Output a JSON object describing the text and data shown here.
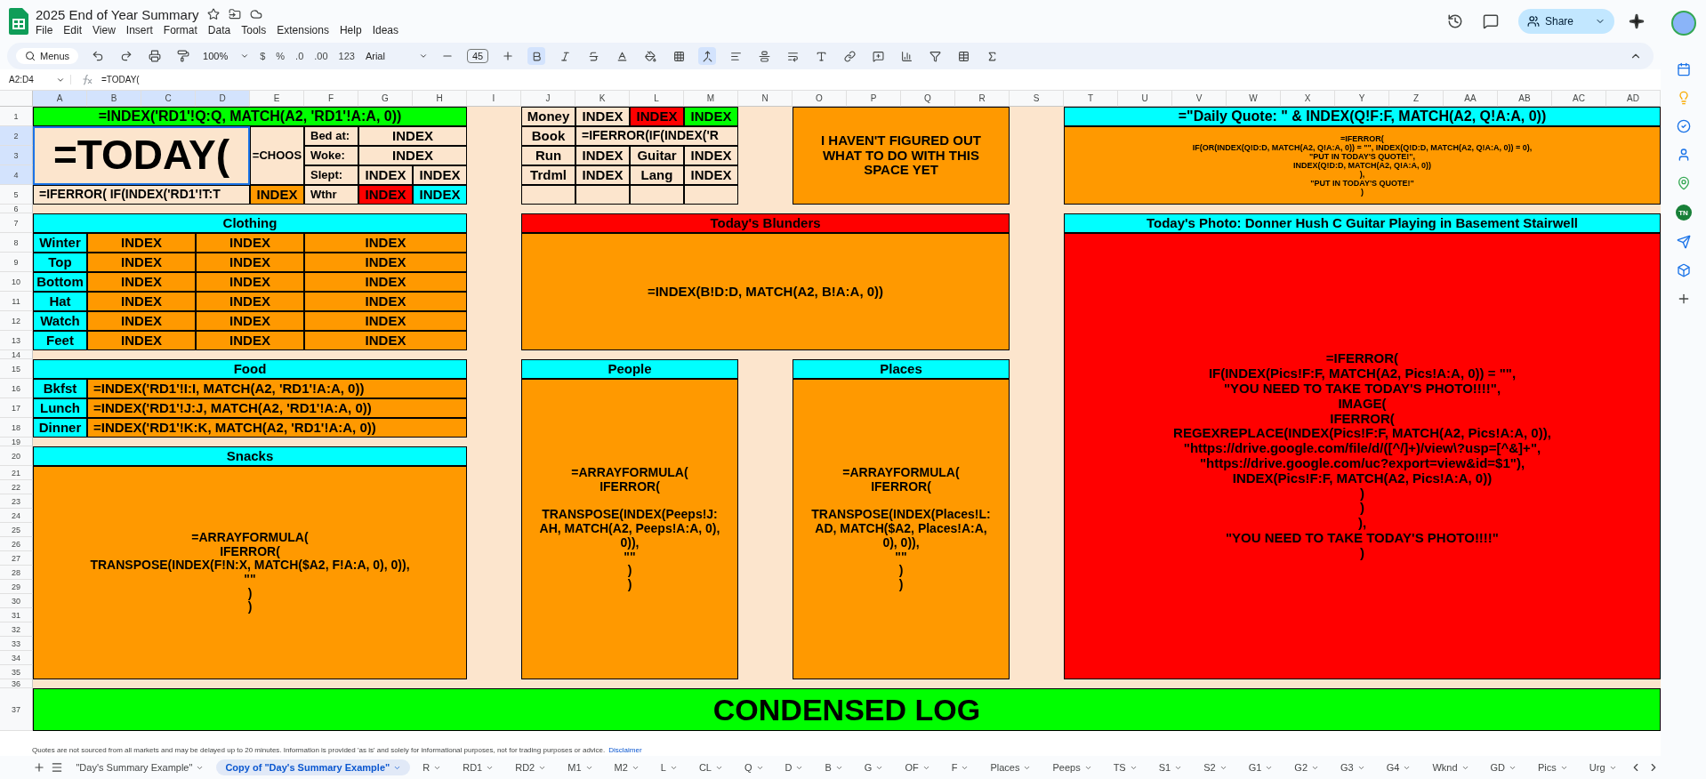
{
  "document": {
    "title": "2025 End of Year Summary"
  },
  "menu": [
    "File",
    "Edit",
    "View",
    "Insert",
    "Format",
    "Data",
    "Tools",
    "Extensions",
    "Help",
    "Ideas"
  ],
  "share": "Share",
  "toolbar": {
    "search": "Menus",
    "zoom": "100%",
    "number_formats": [
      "$",
      "%",
      ".0",
      ".00",
      "123"
    ],
    "font": "Arial",
    "font_size": "45",
    "bold": {
      "selected": true
    },
    "merge_cells": {
      "selected": true
    }
  },
  "formula_bar": {
    "cell": "A2:D4",
    "formula": "=TODAY("
  },
  "side_panel": {
    "badge": "TN"
  },
  "columns": [
    {
      "label": "A",
      "selected": true
    },
    {
      "label": "B",
      "selected": true
    },
    {
      "label": "C",
      "selected": true
    },
    {
      "label": "D",
      "selected": true
    },
    {
      "label": "E",
      "selected": false
    },
    {
      "label": "F",
      "selected": false
    },
    {
      "label": "G",
      "selected": false
    },
    {
      "label": "H",
      "selected": false
    },
    {
      "label": "I",
      "selected": false
    },
    {
      "label": "J",
      "selected": false
    },
    {
      "label": "K",
      "selected": false
    },
    {
      "label": "L",
      "selected": false
    },
    {
      "label": "M",
      "selected": false
    },
    {
      "label": "N",
      "selected": false
    },
    {
      "label": "O",
      "selected": false
    },
    {
      "label": "P",
      "selected": false
    },
    {
      "label": "Q",
      "selected": false
    },
    {
      "label": "R",
      "selected": false
    },
    {
      "label": "S",
      "selected": false
    },
    {
      "label": "T",
      "selected": false
    },
    {
      "label": "U",
      "selected": false
    },
    {
      "label": "V",
      "selected": false
    },
    {
      "label": "W",
      "selected": false
    },
    {
      "label": "X",
      "selected": false
    },
    {
      "label": "Y",
      "selected": false
    },
    {
      "label": "Z",
      "selected": false
    },
    {
      "label": "AA",
      "selected": false
    },
    {
      "label": "AB",
      "selected": false
    },
    {
      "label": "AC",
      "selected": false
    },
    {
      "label": "AD",
      "selected": false
    }
  ],
  "rows": [
    {
      "label": "1",
      "selected": false
    },
    {
      "label": "2",
      "selected": true
    },
    {
      "label": "3",
      "selected": true
    },
    {
      "label": "4",
      "selected": true
    },
    {
      "label": "5",
      "selected": false
    },
    {
      "label": "6",
      "selected": false
    },
    {
      "label": "7",
      "selected": false
    },
    {
      "label": "8",
      "selected": false
    },
    {
      "label": "9",
      "selected": false
    },
    {
      "label": "10",
      "selected": false
    },
    {
      "label": "11",
      "selected": false
    },
    {
      "label": "12",
      "selected": false
    },
    {
      "label": "13",
      "selected": false
    },
    {
      "label": "14",
      "selected": false
    },
    {
      "label": "15",
      "selected": false
    },
    {
      "label": "16",
      "selected": false
    },
    {
      "label": "17",
      "selected": false
    },
    {
      "label": "18",
      "selected": false
    },
    {
      "label": "19",
      "selected": false
    },
    {
      "label": "20",
      "selected": false
    },
    {
      "label": "21",
      "selected": false
    },
    {
      "label": "22",
      "selected": false
    },
    {
      "label": "23",
      "selected": false
    },
    {
      "label": "24",
      "selected": false
    },
    {
      "label": "25",
      "selected": false
    },
    {
      "label": "26",
      "selected": false
    },
    {
      "label": "27",
      "selected": false
    },
    {
      "label": "28",
      "selected": false
    },
    {
      "label": "29",
      "selected": false
    },
    {
      "label": "30",
      "selected": false
    },
    {
      "label": "31",
      "selected": false
    },
    {
      "label": "32",
      "selected": false
    },
    {
      "label": "33",
      "selected": false
    },
    {
      "label": "34",
      "selected": false
    },
    {
      "label": "35",
      "selected": false
    },
    {
      "label": "36",
      "selected": false
    },
    {
      "label": "37",
      "selected": false
    }
  ],
  "cells": [
    {
      "text": "=INDEX('RD1'!Q:Q, MATCH(A2, 'RD1'!A:A, 0))",
      "color": "#00ff00",
      "selected": false
    },
    {
      "text": "=TODAY(",
      "color": "#fce5cd",
      "selected": true
    },
    {
      "text": "=CHOOS",
      "color": "#fce5cd",
      "selected": false
    },
    {
      "text": "Bed at:",
      "color": "#fce5cd",
      "selected": false
    },
    {
      "text": "INDEX",
      "color": "#fce5cd",
      "selected": false
    },
    {
      "text": "Woke:",
      "color": "#fce5cd",
      "selected": false
    },
    {
      "text": "INDEX",
      "color": "#fce5cd",
      "selected": false
    },
    {
      "text": "Slept:",
      "color": "#fce5cd",
      "selected": false
    },
    {
      "text": "INDEX",
      "color": "#fce5cd",
      "selected": false
    },
    {
      "text": "INDEX",
      "color": "#fce5cd",
      "selected": false
    },
    {
      "text": "=IFERROR( IF(INDEX('RD1'!T:T",
      "color": "#fce5cd",
      "selected": false
    },
    {
      "text": "INDEX",
      "color": "#ff9900",
      "selected": false
    },
    {
      "text": "Wthr",
      "color": "#fce5cd",
      "selected": false
    },
    {
      "text": "INDEX",
      "color": "#ff0000",
      "selected": false
    },
    {
      "text": "INDEX",
      "color": "#00ffff",
      "selected": false
    },
    {
      "text": "Money",
      "color": "#fce5cd",
      "selected": false
    },
    {
      "text": "INDEX",
      "color": "#fce5cd",
      "selected": false
    },
    {
      "text": "INDEX",
      "color": "#ff0000",
      "selected": false
    },
    {
      "text": "INDEX",
      "color": "#00ff00",
      "selected": false
    },
    {
      "text": "Book",
      "color": "#fce5cd",
      "selected": false
    },
    {
      "text": "=IFERROR(IF(INDEX('R",
      "color": "#fce5cd",
      "selected": false
    },
    {
      "text": "Run",
      "color": "#fce5cd",
      "selected": false
    },
    {
      "text": "INDEX",
      "color": "#fce5cd",
      "selected": false
    },
    {
      "text": "Guitar",
      "color": "#fce5cd",
      "selected": false
    },
    {
      "text": "INDEX",
      "color": "#fce5cd",
      "selected": false
    },
    {
      "text": "Trdml",
      "color": "#fce5cd",
      "selected": false
    },
    {
      "text": "INDEX",
      "color": "#fce5cd",
      "selected": false
    },
    {
      "text": "Lang",
      "color": "#fce5cd",
      "selected": false
    },
    {
      "text": "INDEX",
      "color": "#fce5cd",
      "selected": false
    },
    {
      "color": "#fce5cd",
      "selected": false
    },
    {
      "color": "#fce5cd",
      "selected": false
    },
    {
      "color": "#fce5cd",
      "selected": false
    },
    {
      "color": "#fce5cd",
      "selected": false
    },
    {
      "text": "I HAVEN'T FIGURED OUT\nWHAT TO DO WITH THIS\nSPACE YET",
      "color": "#ff9900",
      "selected": false
    },
    {
      "text": "=\"Daily Quote: \" & INDEX(Q!F:F, MATCH(A2, Q!A:A, 0))",
      "color": "#00ffff",
      "selected": false
    },
    {
      "text": "=IFERROR(\nIF(OR(INDEX(Q!D:D, MATCH(A2, Q!A:A, 0)) = \"\", INDEX(Q!D:D, MATCH(A2, Q!A:A, 0)) = 0),\n\"PUT IN TODAY'S QUOTE!\",\nINDEX(Q!D:D, MATCH(A2, Q!A:A, 0))\n),\n\"PUT IN TODAY'S QUOTE!\"\n)",
      "color": "#ff9900",
      "selected": false
    },
    {
      "text": "Clothing",
      "color": "#00ffff",
      "selected": false
    },
    {
      "text": "Winter",
      "color": "#00ffff",
      "selected": false
    },
    {
      "text": "INDEX",
      "color": "#ff9900",
      "selected": false
    },
    {
      "text": "INDEX",
      "color": "#ff9900",
      "selected": false
    },
    {
      "text": "INDEX",
      "color": "#ff9900",
      "selected": false
    },
    {
      "text": "Top",
      "color": "#00ffff",
      "selected": false
    },
    {
      "text": "INDEX",
      "color": "#ff9900",
      "selected": false
    },
    {
      "text": "INDEX",
      "color": "#ff9900",
      "selected": false
    },
    {
      "text": "INDEX",
      "color": "#ff9900",
      "selected": false
    },
    {
      "text": "Bottom",
      "color": "#00ffff",
      "selected": false
    },
    {
      "text": "INDEX",
      "color": "#ff9900",
      "selected": false
    },
    {
      "text": "INDEX",
      "color": "#ff9900",
      "selected": false
    },
    {
      "text": "INDEX",
      "color": "#ff9900",
      "selected": false
    },
    {
      "text": "Hat",
      "color": "#00ffff",
      "selected": false
    },
    {
      "text": "INDEX",
      "color": "#ff9900",
      "selected": false
    },
    {
      "text": "INDEX",
      "color": "#ff9900",
      "selected": false
    },
    {
      "text": "INDEX",
      "color": "#ff9900",
      "selected": false
    },
    {
      "text": "Watch",
      "color": "#00ffff",
      "selected": false
    },
    {
      "text": "INDEX",
      "color": "#ff9900",
      "selected": false
    },
    {
      "text": "INDEX",
      "color": "#ff9900",
      "selected": false
    },
    {
      "text": "INDEX",
      "color": "#ff9900",
      "selected": false
    },
    {
      "text": "Feet",
      "color": "#00ffff",
      "selected": false
    },
    {
      "text": "INDEX",
      "color": "#ff9900",
      "selected": false
    },
    {
      "text": "INDEX",
      "color": "#ff9900",
      "selected": false
    },
    {
      "text": "INDEX",
      "color": "#ff9900",
      "selected": false
    },
    {
      "text": "Today's Blunders",
      "color": "#ff0000",
      "selected": false
    },
    {
      "text": "=INDEX(B!D:D, MATCH(A2, B!A:A, 0))",
      "color": "#ff9900",
      "selected": false
    },
    {
      "text": "Today's Photo: Donner Hush C Guitar Playing in Basement Stairwell",
      "color": "#00ffff",
      "selected": false
    },
    {
      "text": "=IFERROR(\nIF(INDEX(Pics!F:F, MATCH(A2, Pics!A:A, 0)) = \"\",\n\"YOU NEED TO TAKE TODAY'S PHOTO!!!!\",\nIMAGE(\nIFERROR(\nREGEXREPLACE(INDEX(Pics!F:F, MATCH(A2, Pics!A:A, 0)),\n\"https://drive.google.com/file/d/([^/]+)/view\\?usp=[^&]+\",\n\"https://drive.google.com/uc?export=view&id=$1\"),\nINDEX(Pics!F:F, MATCH(A2, Pics!A:A, 0))\n)\n)\n),\n\"YOU NEED TO TAKE TODAY'S PHOTO!!!!\"\n)",
      "color": "#ff0000",
      "selected": false
    },
    {
      "text": "Food",
      "color": "#00ffff",
      "selected": false
    },
    {
      "text": "Bkfst",
      "color": "#00ffff",
      "selected": false
    },
    {
      "text": "=INDEX('RD1'!I:I, MATCH(A2, 'RD1'!A:A, 0))",
      "color": "#ff9900",
      "selected": false
    },
    {
      "text": "Lunch",
      "color": "#00ffff",
      "selected": false
    },
    {
      "text": "=INDEX('RD1'!J:J, MATCH(A2, 'RD1'!A:A, 0))",
      "color": "#ff9900",
      "selected": false
    },
    {
      "text": "Dinner",
      "color": "#00ffff",
      "selected": false
    },
    {
      "text": "=INDEX('RD1'!K:K, MATCH(A2, 'RD1'!A:A, 0))",
      "color": "#ff9900",
      "selected": false
    },
    {
      "text": "People",
      "color": "#00ffff",
      "selected": false
    },
    {
      "text": "=ARRAYFORMULA(\nIFERROR(\n\nTRANSPOSE(INDEX(Peeps!J:\nAH, MATCH(A2, Peeps!A:A, 0),\n0)),\n\"\"\n)\n)",
      "color": "#ff9900",
      "selected": false
    },
    {
      "text": "Places",
      "color": "#00ffff",
      "selected": false
    },
    {
      "text": "=ARRAYFORMULA(\nIFERROR(\n\nTRANSPOSE(INDEX(Places!L:\nAD, MATCH($A2, Places!A:A,\n0), 0)),\n\"\"\n)\n)",
      "color": "#ff9900",
      "selected": false
    },
    {
      "text": "Snacks",
      "color": "#00ffff",
      "selected": false
    },
    {
      "text": "=ARRAYFORMULA(\nIFERROR(\nTRANSPOSE(INDEX(F!N:X, MATCH($A2, F!A:A, 0), 0)),\n\"\"\n)\n)",
      "color": "#ff9900",
      "selected": false
    },
    {
      "text": "CONDENSED LOG",
      "color": "#00ff00",
      "selected": false
    }
  ],
  "notice": {
    "text": "Quotes are not sourced from all markets and may be delayed up to 20 minutes. Information is provided 'as is' and solely for informational purposes, not for trading purposes or advice.",
    "link": "Disclaimer"
  },
  "sheet_tabs": [
    {
      "label": "\"Day's Summary Example\"",
      "selected": false
    },
    {
      "label": "Copy of \"Day's Summary Example\"",
      "selected": true
    },
    {
      "label": "R",
      "selected": false
    },
    {
      "label": "RD1",
      "selected": false
    },
    {
      "label": "RD2",
      "selected": false
    },
    {
      "label": "M1",
      "selected": false
    },
    {
      "label": "M2",
      "selected": false
    },
    {
      "label": "L",
      "selected": false
    },
    {
      "label": "CL",
      "selected": false
    },
    {
      "label": "Q",
      "selected": false
    },
    {
      "label": "D",
      "selected": false
    },
    {
      "label": "B",
      "selected": false
    },
    {
      "label": "G",
      "selected": false
    },
    {
      "label": "OF",
      "selected": false
    },
    {
      "label": "F",
      "selected": false
    },
    {
      "label": "Places",
      "selected": false
    },
    {
      "label": "Peeps",
      "selected": false
    },
    {
      "label": "TS",
      "selected": false
    },
    {
      "label": "S1",
      "selected": false
    },
    {
      "label": "S2",
      "selected": false
    },
    {
      "label": "G1",
      "selected": false
    },
    {
      "label": "G2",
      "selected": false
    },
    {
      "label": "G3",
      "selected": false
    },
    {
      "label": "G4",
      "selected": false
    },
    {
      "label": "Wknd",
      "selected": false
    },
    {
      "label": "GD",
      "selected": false
    },
    {
      "label": "Pics",
      "selected": false
    },
    {
      "label": "Urg",
      "selected": false
    }
  ]
}
